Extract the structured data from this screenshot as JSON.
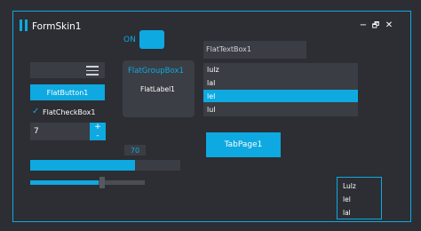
{
  "window": {
    "title": "FormSkin1",
    "accent": "#0ea9e0",
    "background": "#2c2e33"
  },
  "toggle": {
    "label": "ON",
    "state": true
  },
  "menu_icon": "hamburger-icon",
  "flat_button": {
    "label": "FlatButton1"
  },
  "flat_checkbox": {
    "label": "FlatCheckBox1",
    "checked": true,
    "check_glyph": "✓"
  },
  "numeric": {
    "value": "7",
    "plus": "+",
    "minus": "-"
  },
  "group_box": {
    "title": "FlatGroupBox1",
    "label": "FlatLabel1"
  },
  "textbox": {
    "value": "FlatTextBox1"
  },
  "listbox": {
    "items": [
      "lulz",
      "lal",
      "lel",
      "lul"
    ],
    "selected_index": 2
  },
  "tab_page": {
    "label": "TabPage1"
  },
  "progress": {
    "value": 70,
    "label": "70"
  },
  "trackbar": {
    "value": 0.6
  },
  "dropdown_list": {
    "items": [
      "Lulz",
      "lel",
      "lal"
    ]
  },
  "window_controls": {
    "minimize": "−",
    "restore": "🗗",
    "close": "✕"
  }
}
